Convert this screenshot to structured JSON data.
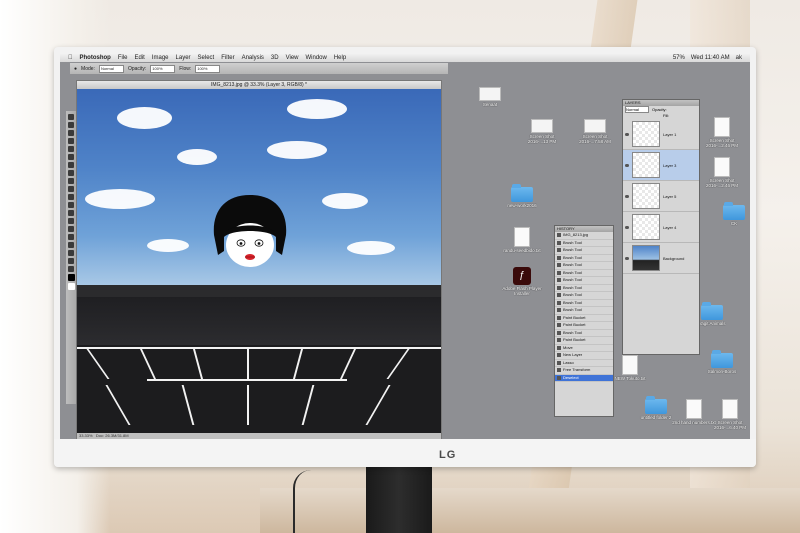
{
  "menubar": {
    "app_name": "Photoshop",
    "items": [
      "File",
      "Edit",
      "Image",
      "Layer",
      "Select",
      "Filter",
      "Analysis",
      "3D",
      "View",
      "Window",
      "Help"
    ],
    "clock": "Wed 11:40 AM",
    "battery": "57%",
    "user": "ak"
  },
  "options_bar": {
    "mode_label": "Mode:",
    "mode_value": "Normal",
    "opacity_label": "Opacity:",
    "opacity_value": "100%",
    "flow_label": "Flow:",
    "flow_value": "100%"
  },
  "document": {
    "title": "IMG_8213.jpg @ 33.3% (Layer 3, RGB/8) *",
    "zoom": "33.33%",
    "doc_size": "Doc: 26.3M/31.8M"
  },
  "history_panel": {
    "title": "HISTORY",
    "file": "IMG_8213.jpg",
    "rows": [
      "Brush Tool",
      "Brush Tool",
      "Brush Tool",
      "Brush Tool",
      "Brush Tool",
      "Brush Tool",
      "Brush Tool",
      "Brush Tool",
      "Brush Tool",
      "Brush Tool",
      "Paint Bucket",
      "Paint Bucket",
      "Brush Tool",
      "Paint Bucket",
      "Move",
      "New Layer",
      "Lasso",
      "Free Transform",
      "Deselect"
    ],
    "selected_index": 18
  },
  "layers_panel": {
    "title": "LAYERS",
    "blend_mode": "Normal",
    "opacity_label": "Opacity:",
    "fill_label": "Fill:",
    "layers": [
      {
        "name": "Layer 1",
        "selected": false
      },
      {
        "name": "Layer 3",
        "selected": true
      },
      {
        "name": "Layer 5",
        "selected": false
      },
      {
        "name": "Layer 4",
        "selected": false
      },
      {
        "name": "Background",
        "selected": false
      }
    ]
  },
  "desktop": {
    "items": [
      {
        "label": "Senaat",
        "kind": "shot"
      },
      {
        "label": "Screen Shot 2016-...13 PM",
        "kind": "shot"
      },
      {
        "label": "Screen Shot 2016-...7.58 AM",
        "kind": "shot"
      },
      {
        "label": "Screen Shot 2016-...2.46 PM",
        "kind": "doc"
      },
      {
        "label": "Screen Shot 2016-...2.46 PM",
        "kind": "doc"
      },
      {
        "label": "new-work2016",
        "kind": "folder"
      },
      {
        "label": "CK",
        "kind": "folder"
      },
      {
        "label": "randu-seedbido.txt",
        "kind": "doc"
      },
      {
        "label": "Adobe Flash Player Installer",
        "kind": "flash"
      },
      {
        "label": "Vagit Animals",
        "kind": "folder"
      },
      {
        "label": "NEW Tokuto.txt",
        "kind": "doc"
      },
      {
        "label": "Salmon-Boros",
        "kind": "folder"
      },
      {
        "label": "untitled folder 2",
        "kind": "folder"
      },
      {
        "label": "2nd hand numbers.txt",
        "kind": "doc"
      },
      {
        "label": "Screen Shot 2016-...6.40 PM",
        "kind": "doc"
      }
    ]
  },
  "monitor": {
    "brand": "LG"
  },
  "colors": {
    "sky_top": "#3a69b8",
    "desktop": "#8e8f93",
    "selection": "#3f73d7",
    "folder": "#4fa3e3"
  }
}
